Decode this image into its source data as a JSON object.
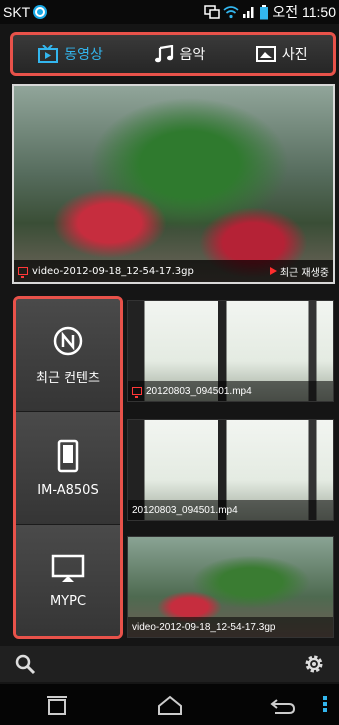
{
  "status_bar": {
    "carrier": "SKT",
    "time": "오전 11:50"
  },
  "tabs": [
    {
      "label": "동영상",
      "icon": "video-icon",
      "active": true
    },
    {
      "label": "음악",
      "icon": "music-note-icon",
      "active": false
    },
    {
      "label": "사진",
      "icon": "photo-icon",
      "active": false
    }
  ],
  "hero": {
    "filename": "video-2012-09-18_12-54-17.3gp",
    "recent_label": "최근 재생중"
  },
  "devices": [
    {
      "label": "최근 컨텐츠",
      "icon": "recent-n-icon"
    },
    {
      "label": "IM-A850S",
      "icon": "phone-icon"
    },
    {
      "label": "MYPC",
      "icon": "monitor-icon"
    }
  ],
  "files": [
    {
      "name": "20120803_094501.mp4"
    },
    {
      "name": "20120803_094501.mp4"
    },
    {
      "name": "video-2012-09-18_12-54-17.3gp"
    }
  ],
  "colors": {
    "accent": "#33b6ee",
    "highlight_border": "#e8524a",
    "play_red": "#ff2d2d"
  }
}
